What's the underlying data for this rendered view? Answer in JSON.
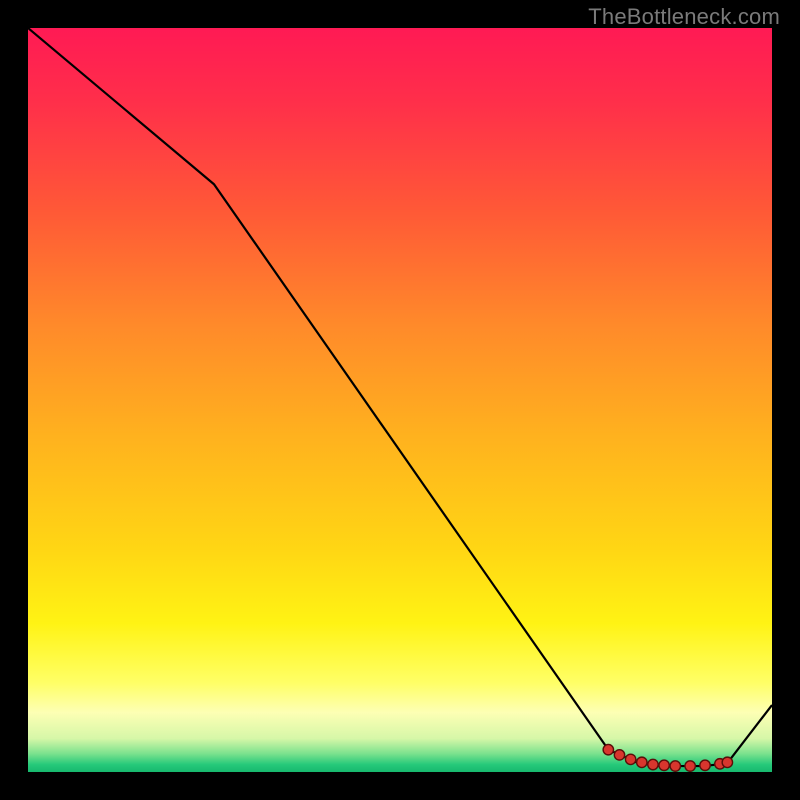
{
  "watermark": "TheBottleneck.com",
  "colors": {
    "bg": "#000000",
    "line": "#000000",
    "marker": "#d8362e",
    "gradient_stops": [
      {
        "offset": 0.0,
        "color": "#ff1a54"
      },
      {
        "offset": 0.1,
        "color": "#ff2f4a"
      },
      {
        "offset": 0.25,
        "color": "#ff5a36"
      },
      {
        "offset": 0.4,
        "color": "#ff8a2a"
      },
      {
        "offset": 0.55,
        "color": "#ffb21e"
      },
      {
        "offset": 0.7,
        "color": "#ffd614"
      },
      {
        "offset": 0.8,
        "color": "#fff314"
      },
      {
        "offset": 0.88,
        "color": "#ffff66"
      },
      {
        "offset": 0.92,
        "color": "#fdffb4"
      },
      {
        "offset": 0.955,
        "color": "#d6f7a8"
      },
      {
        "offset": 0.975,
        "color": "#7de28e"
      },
      {
        "offset": 0.99,
        "color": "#26c97a"
      },
      {
        "offset": 1.0,
        "color": "#17b86e"
      }
    ]
  },
  "chart_data": {
    "type": "line",
    "title": "",
    "xlabel": "",
    "ylabel": "",
    "xlim": [
      0,
      100
    ],
    "ylim": [
      0,
      100
    ],
    "x": [
      0,
      25,
      78,
      82,
      85,
      88,
      91,
      94,
      100
    ],
    "values": [
      100,
      79,
      3,
      1.2,
      0.8,
      0.8,
      0.8,
      1.2,
      9
    ],
    "markers_x": [
      78,
      79.5,
      81,
      82.5,
      84,
      85.5,
      87,
      89,
      91,
      93,
      94
    ],
    "markers_y": [
      3.0,
      2.3,
      1.7,
      1.3,
      1.0,
      0.9,
      0.8,
      0.8,
      0.9,
      1.1,
      1.3
    ],
    "grid": false,
    "legend": false
  }
}
